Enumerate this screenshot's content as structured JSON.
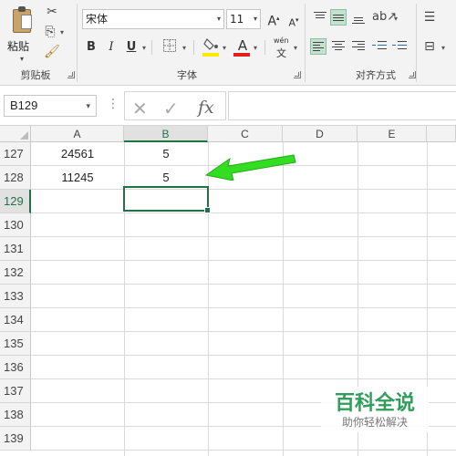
{
  "ribbon": {
    "clipboard": {
      "paste_label": "粘贴",
      "group_label": "剪贴板"
    },
    "font": {
      "font_name": "宋体",
      "font_size": "11",
      "bold": "B",
      "italic": "I",
      "underline": "U",
      "grow_font": "A",
      "shrink_font": "A",
      "font_color_letter": "A",
      "phonetic_top": "wén",
      "phonetic_bottom": "文",
      "group_label": "字体"
    },
    "alignment": {
      "group_label": "对齐方式"
    }
  },
  "formula_bar": {
    "name_box": "B129",
    "cancel_glyph": "✕",
    "enter_glyph": "✓",
    "fx_glyph": "fx",
    "formula": ""
  },
  "sheet": {
    "columns": [
      "A",
      "B",
      "C",
      "D",
      "E"
    ],
    "rows": [
      "127",
      "128",
      "129",
      "130",
      "131",
      "132",
      "133",
      "134",
      "135",
      "136",
      "137",
      "138",
      "139"
    ],
    "cells": {
      "A127": "24561",
      "B127": "5",
      "A128": "11245",
      "B128": "5"
    },
    "selected_column": "B",
    "selected_row": "129"
  },
  "colors": {
    "accent": "#217346",
    "arrow": "#33dd22",
    "font_color": "#e02020",
    "fill_color": "#ffe800"
  },
  "watermark": {
    "title": "百科全说",
    "subtitle": "助你轻松解决"
  }
}
